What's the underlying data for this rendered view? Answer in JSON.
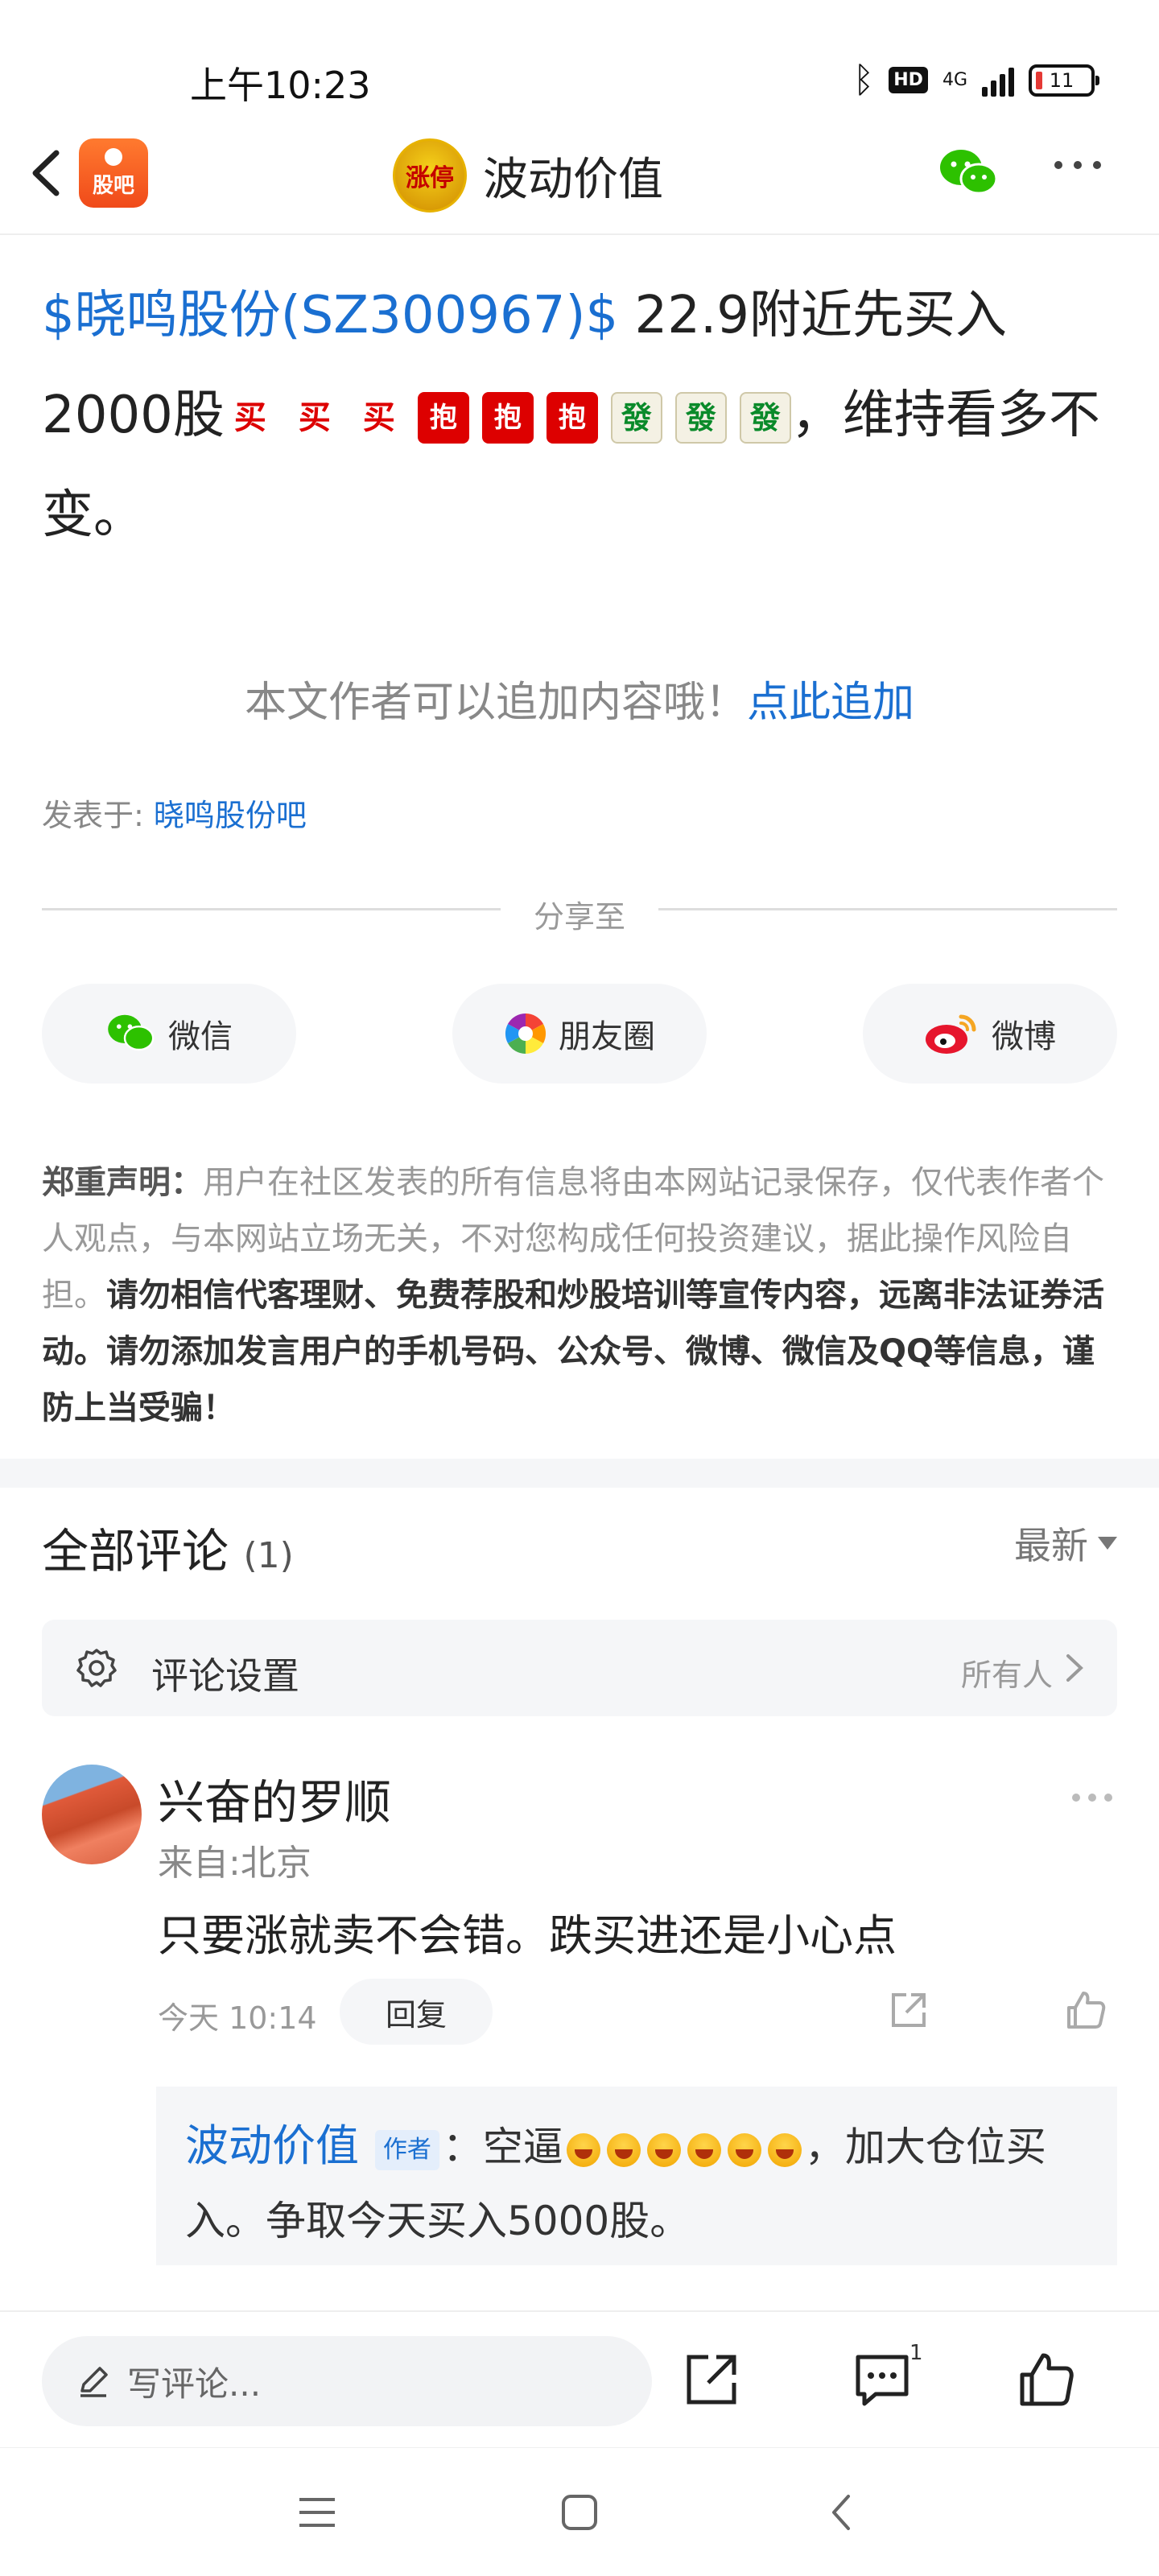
{
  "status_bar": {
    "time": "上午10:23",
    "network": "4G",
    "battery": "11"
  },
  "nav": {
    "app_badge": "股吧",
    "author_name": "波动价值",
    "avatar_text": "涨停"
  },
  "post": {
    "stock_link": "$晓鸣股份(SZ300967)$",
    "text_part1": " 22.9附近先买入2000股",
    "emoji_buy": "买",
    "emoji_bao": "抱",
    "emoji_fa": "發",
    "text_part2": "，维持看多不变。"
  },
  "append": {
    "prompt": "本文作者可以追加内容哦！",
    "link": "点此追加"
  },
  "posted_in": {
    "label": "发表于: ",
    "bar": "晓鸣股份吧"
  },
  "share": {
    "label": "分享至",
    "wechat": "微信",
    "moments": "朋友圈",
    "weibo": "微博"
  },
  "disclaimer": {
    "title": "郑重声明：",
    "normal": "用户在社区发表的所有信息将由本网站记录保存，仅代表作者个人观点，与本网站立场无关，不对您构成任何投资建议，据此操作风险自担。",
    "bold": "请勿相信代客理财、免费荐股和炒股培训等宣传内容，远离非法证券活动。请勿添加发言用户的手机号码、公众号、微博、微信及QQ等信息，谨防上当受骗！"
  },
  "comments": {
    "header": "全部评论",
    "count": "(1)",
    "sort": "最新",
    "settings_label": "评论设置",
    "settings_value": "所有人"
  },
  "comment": {
    "user": "兴奋的罗顺",
    "from": "来自:北京",
    "text": "只要涨就卖不会错。跌买进还是小心点",
    "time": "今天 10:14",
    "reply_label": "回复"
  },
  "reply": {
    "author": "波动价值",
    "tag": "作者",
    "prefix": "：空逼",
    "suffix": "，加大仓位买入。争取今天买入5000股。"
  },
  "bottom": {
    "write_placeholder": "写评论...",
    "comment_count": "1"
  }
}
